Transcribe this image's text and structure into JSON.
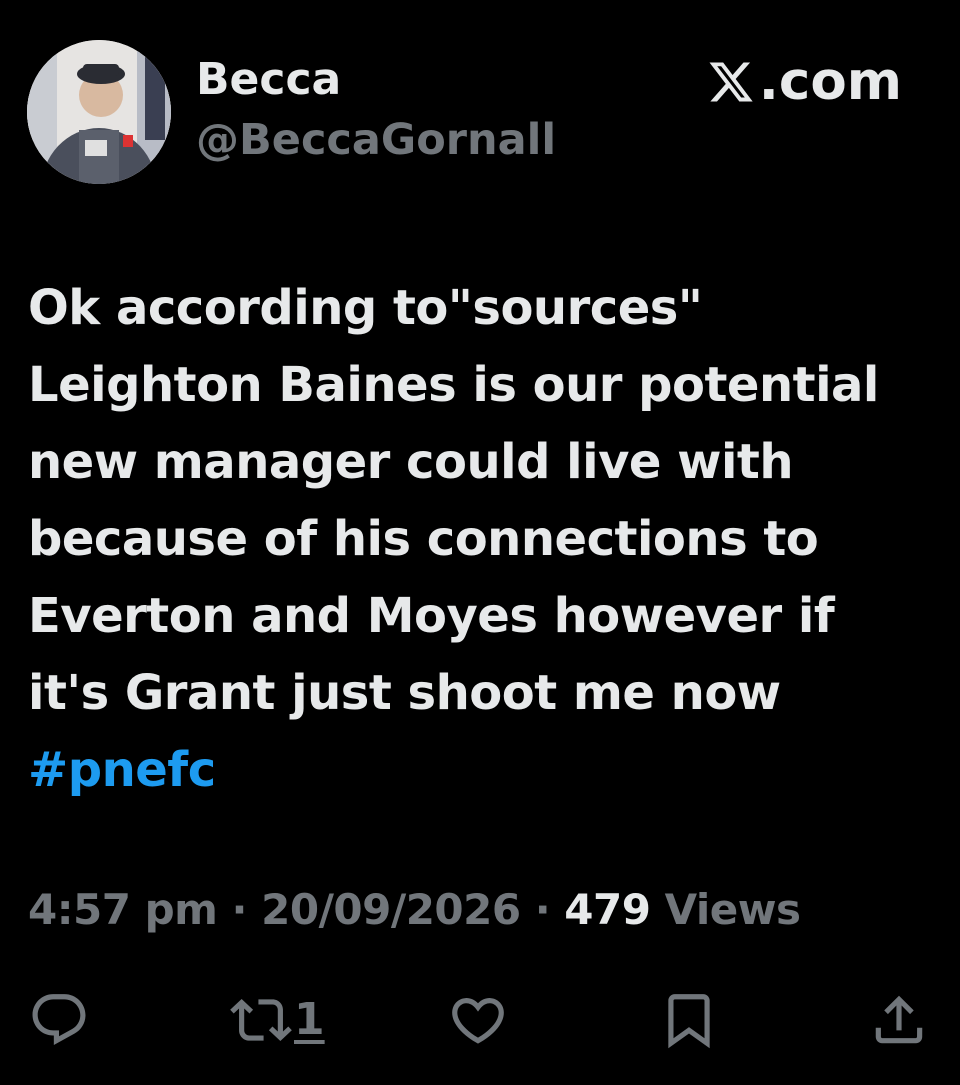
{
  "header": {
    "display_name": "Becca",
    "handle": "@BeccaGornall",
    "brand_text": ".com",
    "avatar_icon": "user-avatar-photo"
  },
  "tweet": {
    "lines": [
      "Ok according to\"sources\"",
      "Leighton Baines is our potential",
      "new manager could live with",
      "because of his connections to",
      "Everton and Moyes however if",
      "it's Grant just shoot me now"
    ],
    "hashtag": "#pnefc"
  },
  "meta": {
    "time": "4:57 pm",
    "separator": " · ",
    "date": "20/09/2026",
    "views_count": "479",
    "views_label": " Views"
  },
  "actions": {
    "reply_icon": "reply-icon",
    "retweet_icon": "retweet-icon",
    "retweet_count": "1",
    "like_icon": "heart-icon",
    "bookmark_icon": "bookmark-icon",
    "share_icon": "share-icon"
  },
  "colors": {
    "background": "#000000",
    "text_primary": "#e7e9ea",
    "text_secondary": "#71767b",
    "accent": "#1d9bf0"
  }
}
